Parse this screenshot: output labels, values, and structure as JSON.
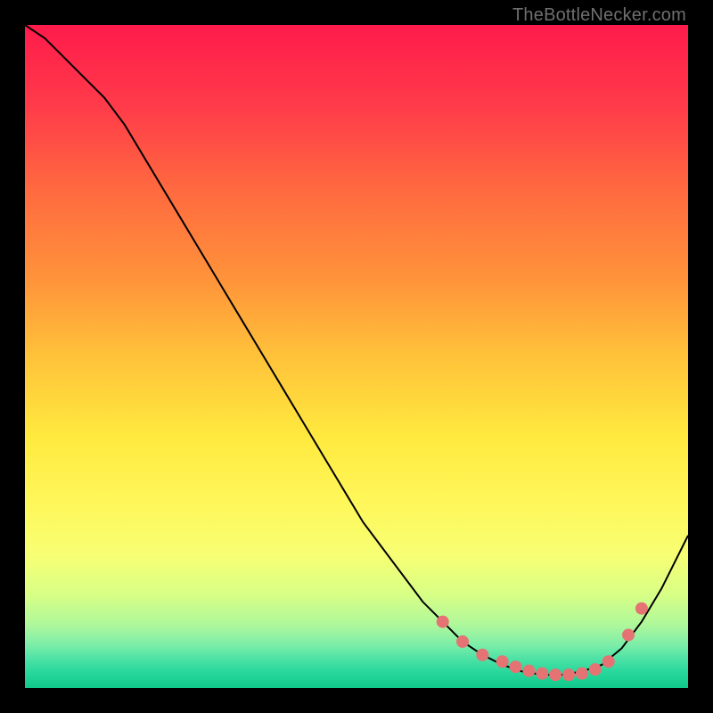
{
  "watermark": "TheBottleNecker.com",
  "chart_data": {
    "type": "line",
    "title": "",
    "xlabel": "",
    "ylabel": "",
    "xlim": [
      0,
      100
    ],
    "ylim": [
      0,
      100
    ],
    "grid": false,
    "series": [
      {
        "name": "curve",
        "x": [
          0,
          3,
          6,
          9,
          12,
          15,
          18,
          21,
          24,
          27,
          30,
          33,
          36,
          39,
          42,
          45,
          48,
          51,
          54,
          57,
          60,
          63,
          66,
          69,
          72,
          75,
          78,
          81,
          84,
          87,
          90,
          93,
          96,
          100
        ],
        "y": [
          100,
          98,
          95,
          92,
          89,
          85,
          80,
          75,
          70,
          65,
          60,
          55,
          50,
          45,
          40,
          35,
          30,
          25,
          21,
          17,
          13,
          10,
          7,
          5,
          3.5,
          2.5,
          2,
          2,
          2.5,
          3.5,
          6,
          10,
          15,
          23
        ],
        "color": "#000000",
        "width": 2
      }
    ],
    "markers": [
      {
        "name": "dots",
        "x": [
          63,
          66,
          69,
          72,
          74,
          76,
          78,
          80,
          82,
          84,
          86,
          88,
          91,
          93
        ],
        "y": [
          10,
          7,
          5,
          4,
          3.2,
          2.6,
          2.2,
          2,
          2,
          2.2,
          2.8,
          4,
          8,
          12
        ],
        "color": "#e57373",
        "radius": 7
      }
    ],
    "background_gradient": {
      "stops": [
        {
          "offset": 0.0,
          "color": "#ff1b4b"
        },
        {
          "offset": 0.12,
          "color": "#ff3a4a"
        },
        {
          "offset": 0.25,
          "color": "#ff6a3f"
        },
        {
          "offset": 0.38,
          "color": "#ff923a"
        },
        {
          "offset": 0.5,
          "color": "#ffc23a"
        },
        {
          "offset": 0.62,
          "color": "#ffe93e"
        },
        {
          "offset": 0.72,
          "color": "#fff75a"
        },
        {
          "offset": 0.8,
          "color": "#f7ff73"
        },
        {
          "offset": 0.86,
          "color": "#d7ff86"
        },
        {
          "offset": 0.905,
          "color": "#aef79b"
        },
        {
          "offset": 0.935,
          "color": "#7ceea8"
        },
        {
          "offset": 0.955,
          "color": "#4fe2a6"
        },
        {
          "offset": 0.975,
          "color": "#29d89c"
        },
        {
          "offset": 1.0,
          "color": "#10c98a"
        }
      ]
    }
  }
}
